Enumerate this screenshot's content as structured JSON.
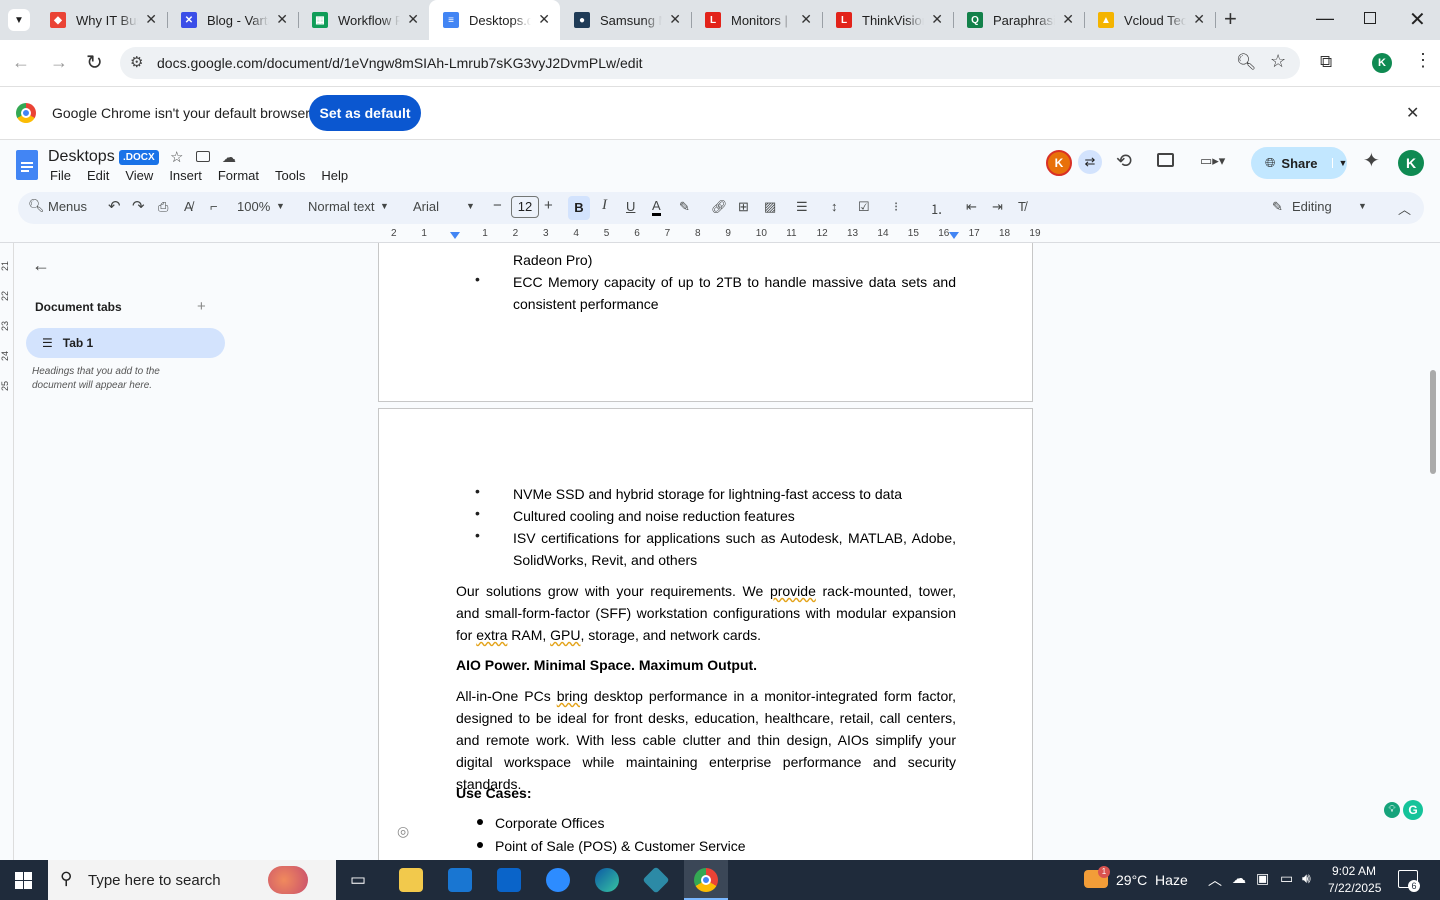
{
  "browser": {
    "tabs": [
      {
        "title": "Why IT Bus",
        "icon": "google-sheets-icon",
        "fav_color": "#ea4335",
        "fav_glyph": "◆"
      },
      {
        "title": "Blog - Varta",
        "icon": "x-logo-icon",
        "fav_color": "#3b4ee8",
        "fav_glyph": "✕"
      },
      {
        "title": "Workflow F",
        "icon": "google-sheets-icon",
        "fav_color": "#0f9d58",
        "fav_glyph": "▦"
      },
      {
        "title": "Desktops.d",
        "icon": "google-docs-icon",
        "fav_color": "#4285f4",
        "fav_glyph": "≡"
      },
      {
        "title": "Samsung M",
        "icon": "site-icon",
        "fav_color": "#1f3b57",
        "fav_glyph": "●"
      },
      {
        "title": "Monitors |",
        "icon": "lenovo-icon",
        "fav_color": "#e2231a",
        "fav_glyph": "L"
      },
      {
        "title": "ThinkVision",
        "icon": "lenovo-icon",
        "fav_color": "#e2231a",
        "fav_glyph": "L"
      },
      {
        "title": "Paraphrasi",
        "icon": "quillbot-icon",
        "fav_color": "#12814a",
        "fav_glyph": "Q"
      },
      {
        "title": "Vcloud Tec",
        "icon": "google-drive-icon",
        "fav_color": "#f4b400",
        "fav_glyph": "▲"
      }
    ],
    "active_tab_index": 3,
    "url": "docs.google.com/document/d/1eVngw8mSIAh-Lmrub7sKG3vyJ2DvmPLw/edit",
    "profile_initial": "K"
  },
  "infobar": {
    "message": "Google Chrome isn't your default browser",
    "button": "Set as default"
  },
  "docs": {
    "title": "Desktops",
    "badge": ".DOCX",
    "menus": [
      "File",
      "Edit",
      "View",
      "Insert",
      "Format",
      "Tools",
      "Help"
    ],
    "share_label": "Share",
    "avatar_initial": "K",
    "collab_initial": "K",
    "toolbar": {
      "search": "Menus",
      "zoom": "100%",
      "style": "Normal text",
      "font": "Arial",
      "font_size": "12",
      "mode": "Editing"
    },
    "ruler_labels": [
      "2",
      "1",
      "",
      "1",
      "2",
      "3",
      "4",
      "5",
      "6",
      "7",
      "8",
      "9",
      "10",
      "11",
      "12",
      "13",
      "14",
      "15",
      "16",
      "17",
      "18",
      "19"
    ],
    "left_ruler_labels": [
      "21",
      "22",
      "23",
      "24",
      "25"
    ]
  },
  "sidebar": {
    "heading": "Document tabs",
    "tab": "Tab 1",
    "hint": "Headings that you add to the document will appear here."
  },
  "document": {
    "page1": {
      "line_top": "Radeon Pro)",
      "bullet": "ECC Memory capacity of up to 2TB to handle massive data sets and consistent performance"
    },
    "page2": {
      "bullets": [
        "NVMe SSD and hybrid storage for lightning-fast access to data",
        "Cultured cooling and noise reduction features",
        "ISV certifications for applications such as Autodesk, MATLAB, Adobe, SolidWorks, Revit, and others"
      ],
      "para1_a": "Our solutions grow with your requirements. We ",
      "para1_u1": "provide",
      "para1_b": " rack-mounted, tower, and small-form-factor (SFF) workstation configurations with modular expansion for ",
      "para1_u2": "extra",
      "para1_c": " RAM, ",
      "para1_u3": "GPU",
      "para1_d": ", storage, and network cards.",
      "heading1": "AIO Power. Minimal Space. Maximum Output.",
      "para2_a": "All-in-One PCs ",
      "para2_u": "bring",
      "para2_b": " desktop performance in a monitor-integrated form factor, designed to be ideal for front desks, education, healthcare, retail, call centers, and remote work. With less cable clutter and thin design, AIOs simplify your digital workspace while maintaining enterprise performance and security standards.",
      "heading2": "Use Cases:",
      "use_cases": [
        "Corporate Offices",
        "Point of Sale (POS) & Customer Service"
      ]
    }
  },
  "taskbar": {
    "search_placeholder": "Type here to search",
    "weather": "29°C  Haze",
    "weather_badge": "1",
    "time": "9:02 AM",
    "date": "7/22/2025",
    "notification_count": "6"
  }
}
